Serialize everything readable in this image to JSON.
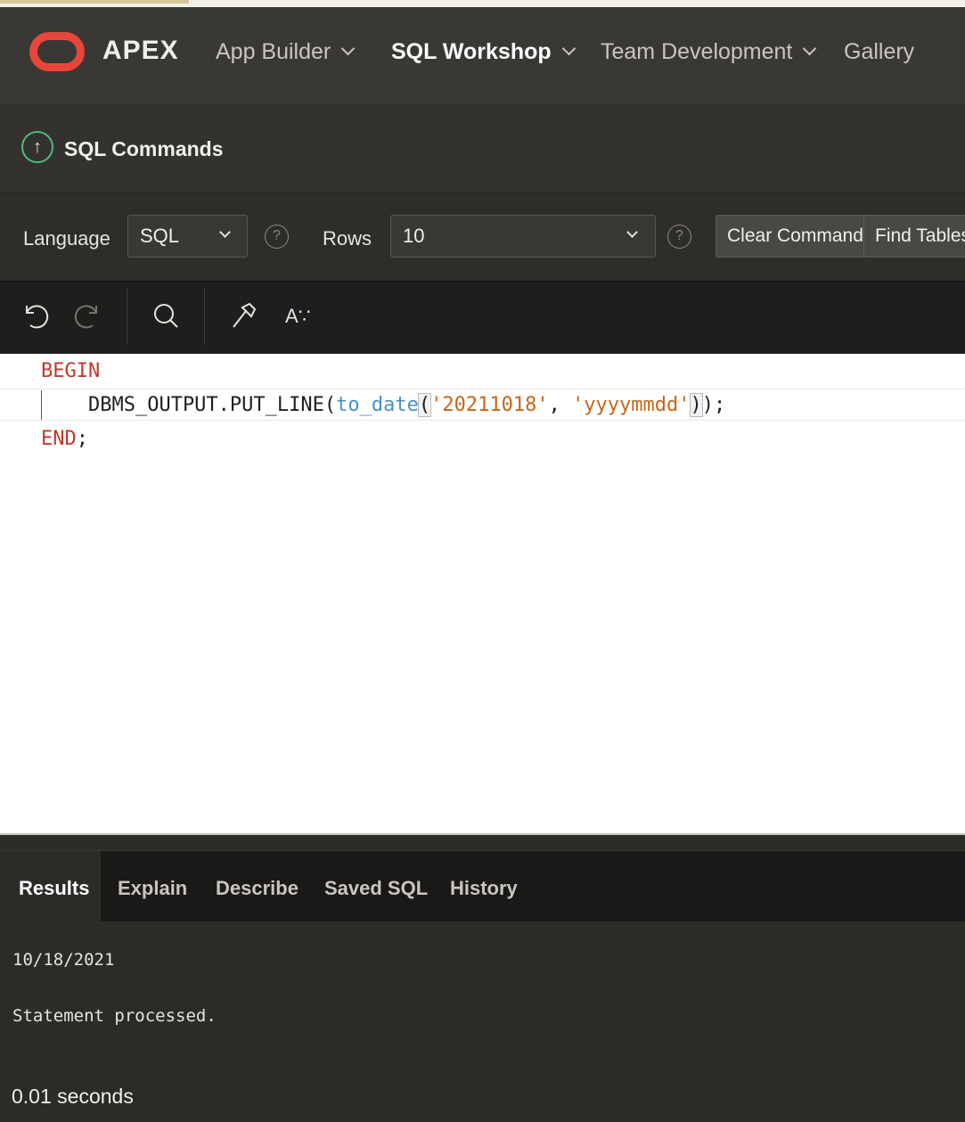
{
  "header": {
    "brand": "APEX",
    "nav": [
      {
        "label": "App Builder",
        "active": false,
        "has_menu": true
      },
      {
        "label": "SQL Workshop",
        "active": true,
        "has_menu": true
      },
      {
        "label": "Team Development",
        "active": false,
        "has_menu": true
      },
      {
        "label": "Gallery",
        "active": false,
        "has_menu": false
      }
    ]
  },
  "page": {
    "title": "SQL Commands"
  },
  "options": {
    "language_label": "Language",
    "language_value": "SQL",
    "rows_label": "Rows",
    "rows_value": "10",
    "clear_command": "Clear Command",
    "find_tables": "Find Tables"
  },
  "toolbar": {
    "format_glyph": "A∵"
  },
  "editor": {
    "line1": "BEGIN",
    "line2_prefix": "    DBMS_OUTPUT.PUT_LINE(",
    "line2_fn": "to_date",
    "line2_arg1": "'20211018'",
    "line2_arg2": "'yyyymmdd'",
    "line2_suffix": ");",
    "line3_kw": "END",
    "line3_suffix": ";"
  },
  "results": {
    "tabs": [
      "Results",
      "Explain",
      "Describe",
      "Saved SQL",
      "History"
    ],
    "active_tab": "Results",
    "output_line": "10/18/2021",
    "status": "Statement processed.",
    "timing": "0.01 seconds"
  },
  "colors": {
    "brand_red": "#e8463a",
    "success_green": "#4dbb7a",
    "keyword": "#c0392b",
    "string": "#c7651a"
  }
}
